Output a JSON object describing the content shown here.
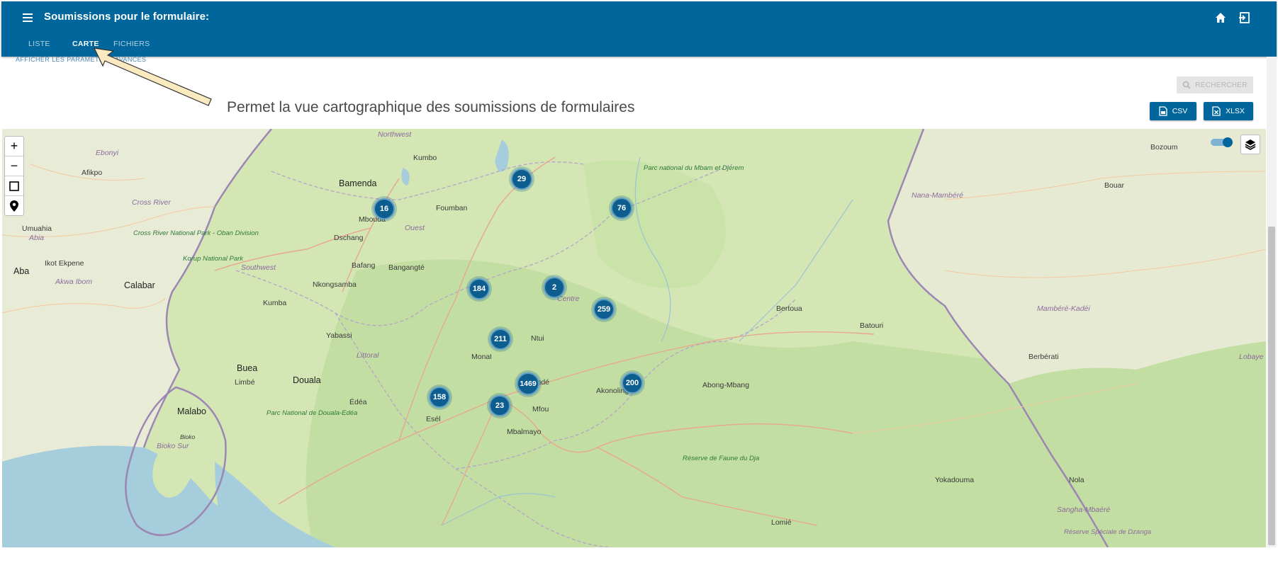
{
  "header": {
    "title": "Soumissions pour le formulaire:",
    "tabs": [
      {
        "label": "LISTE"
      },
      {
        "label": "CARTE"
      },
      {
        "label": "FICHIERS"
      }
    ],
    "active_tab": "CARTE",
    "colors": {
      "appbar": "#00669b"
    }
  },
  "toolbar": {
    "params_label": "AFFICHER LES PARAMÈTRES AVANCÉS",
    "search_label": "RECHERCHER",
    "csv_label": "CSV",
    "xlsx_label": "XLSX"
  },
  "annotation": {
    "text": "Permet la vue cartographique des soumissions de formulaires"
  },
  "map": {
    "controls": {
      "zoom_in": "+",
      "zoom_out": "−"
    },
    "clusters": [
      "29",
      "16",
      "76",
      "184",
      "2",
      "259",
      "211",
      "1469",
      "158",
      "23",
      "200"
    ],
    "places": [
      "Northwest",
      "Kumbo",
      "Ebonyi",
      "Afikpo",
      "Bamenda",
      "Foumban",
      "Parc national du Mbam et Djérem",
      "Bozoum",
      "Bouar",
      "Nana-Mambéré",
      "Cross River",
      "Umuahia",
      "Abia",
      "Mbouda",
      "Ouest",
      "Dschang",
      "Cross River National Park - Oban Division",
      "Korup National Park",
      "Aba",
      "Ikot Ekpene",
      "Southwest",
      "Bafang",
      "Bangangté",
      "Akwa Ibom",
      "Calabar",
      "Nkongsamba",
      "Centre",
      "Kumba",
      "Bertoua",
      "Batouri",
      "Mambéré-Kadéi",
      "Yabassi",
      "Ntui",
      "Littoral",
      "Monatélé",
      "Berbérati",
      "Lobaye",
      "Buea",
      "Limbé",
      "Douala",
      "Abong-Mbang",
      "Malabo",
      "Édéa",
      "Parc National de Douala-Edéa",
      "Bioko",
      "Bioko Sur",
      "Eséka",
      "Mfou",
      "Yaoundé",
      "Akonolinga",
      "Mbalmayo",
      "Yokadouma",
      "Nola",
      "Réserve de Faune du Dja",
      "Lomié",
      "Sangha-Mbaéré",
      "Réserve Spéciale de Dzanga"
    ]
  }
}
